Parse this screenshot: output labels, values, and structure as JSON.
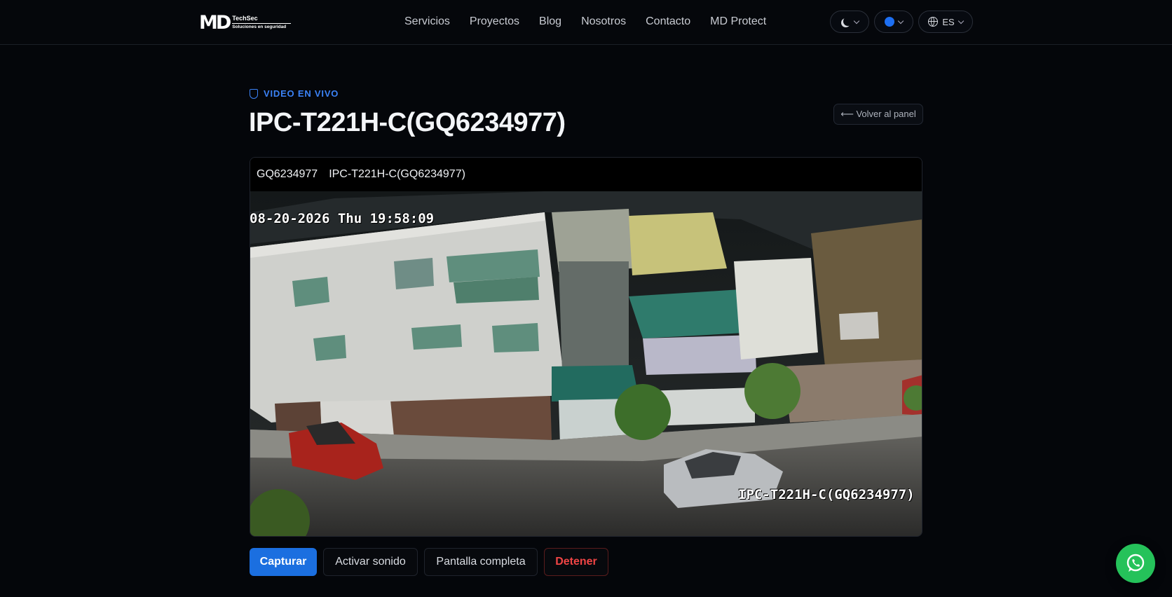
{
  "header": {
    "logo_mark": "MD",
    "logo_brand": "TechSec",
    "logo_tagline": "Soluciones en seguridad",
    "nav": [
      "Servicios",
      "Proyectos",
      "Blog",
      "Nosotros",
      "Contacto",
      "MD Protect"
    ],
    "theme_icon": "moon-icon",
    "accent_color": "#1d6ff2",
    "language": "ES"
  },
  "page": {
    "eyebrow": "VIDEO EN VIVO",
    "title": "IPC-T221H-C(GQ6234977)",
    "back_label": "⟵ Volver al panel"
  },
  "video": {
    "serial": "GQ6234977",
    "camera_name": "IPC-T221H-C(GQ6234977)",
    "osd_timestamp": "08-20-2026 Thu 19:58:09",
    "osd_channel": "IPC-T221H-C(GQ6234977)"
  },
  "actions": {
    "capture": "Capturar",
    "sound": "Activar sonido",
    "fullscreen": "Pantalla completa",
    "stop": "Detener"
  },
  "colors": {
    "primary": "#1b6fe0",
    "danger": "#f04545",
    "whatsapp": "#25c25a"
  }
}
